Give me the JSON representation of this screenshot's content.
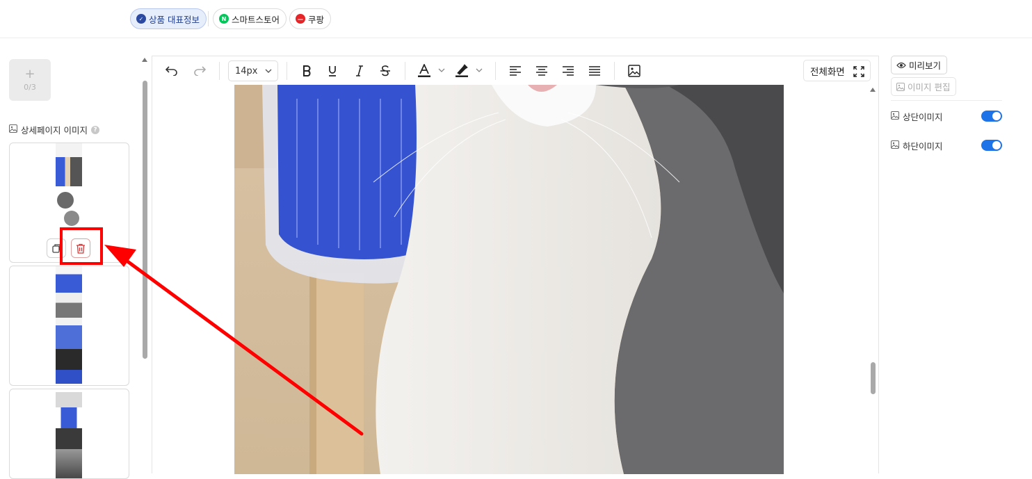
{
  "tabs": [
    {
      "label": "상품 대표정보",
      "active": true,
      "icon": "check-badge-icon",
      "color": "#2b4aa0"
    },
    {
      "label": "스마트스토어",
      "active": false,
      "icon": "naver-n-icon",
      "color": "#03c75a"
    },
    {
      "label": "쿠팡",
      "active": false,
      "icon": "coupang-icon",
      "color": "#e52528"
    }
  ],
  "left_panel": {
    "add_image_count": "0/3",
    "section_title": "상세페이지 이미지",
    "help_glyph": "?"
  },
  "editor": {
    "font_size": "14px",
    "fullscreen_label": "전체화면",
    "toolbar_icons": [
      "undo-icon",
      "redo-icon",
      "bold-icon",
      "underline-icon",
      "italic-icon",
      "strikethrough-icon",
      "text-color-icon",
      "highlight-icon",
      "align-left-icon",
      "align-center-icon",
      "align-right-icon",
      "align-justify-icon",
      "insert-image-icon",
      "fullscreen-icon"
    ]
  },
  "right_panel": {
    "preview_label": "미리보기",
    "edit_image_label": "이미지 편집",
    "top_image_label": "상단이미지",
    "bottom_image_label": "하단이미지",
    "top_image_enabled": true,
    "bottom_image_enabled": true
  },
  "colors": {
    "accent": "#1e73e8",
    "annotation": "#ff0000",
    "active_tab_bg": "#e6edfb"
  }
}
